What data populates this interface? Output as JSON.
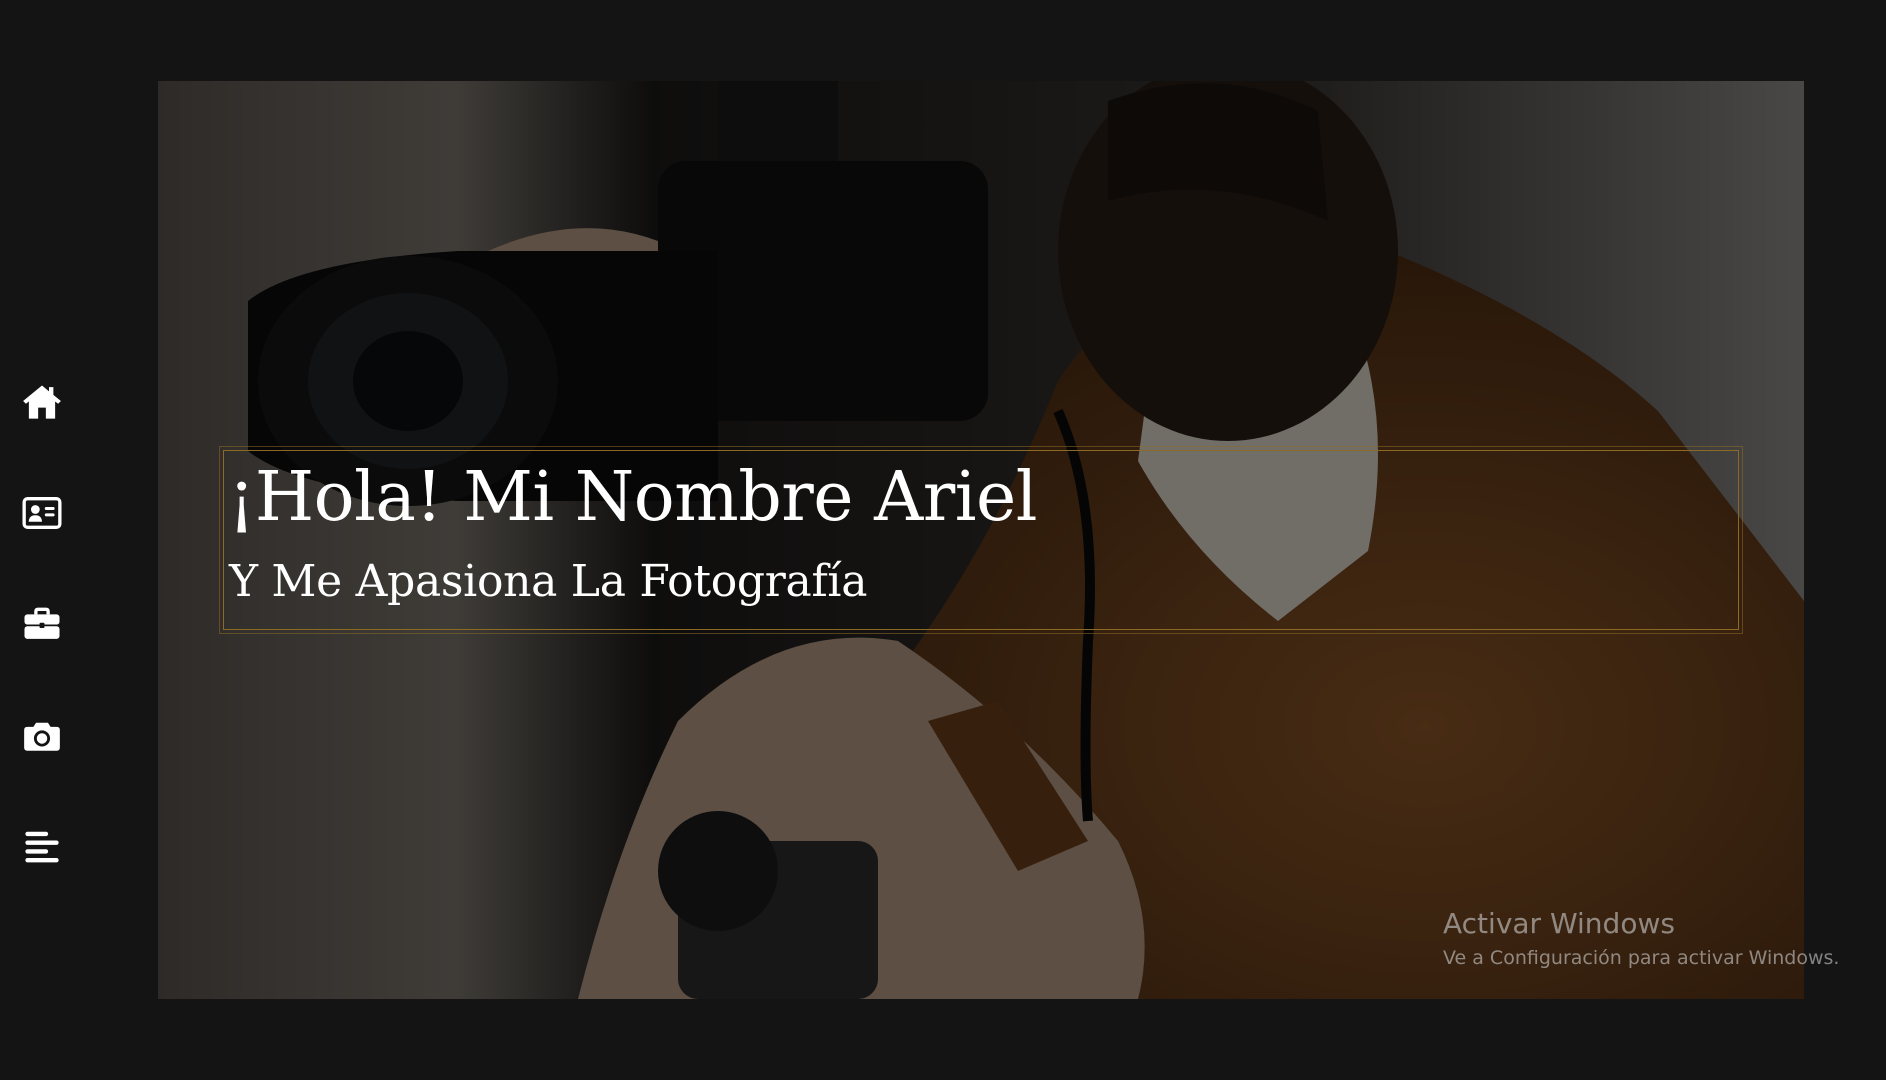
{
  "sidebar": {
    "items": [
      {
        "name": "home",
        "icon": "home-icon"
      },
      {
        "name": "about",
        "icon": "id-card-icon"
      },
      {
        "name": "work",
        "icon": "briefcase-icon"
      },
      {
        "name": "gallery",
        "icon": "camera-icon"
      },
      {
        "name": "menu",
        "icon": "align-left-icon"
      }
    ]
  },
  "hero": {
    "greeting": "¡Hola! Mi Nombre Ariel",
    "subtitle": "Y Me Apasiona La Fotografía",
    "image": "photographer-with-camera"
  },
  "watermark": {
    "title": "Activar Windows",
    "subtitle": "Ve a Configuración para activar Windows."
  },
  "colors": {
    "background": "#141414",
    "accent_border": "#8c6a24",
    "text": "#ffffff",
    "icon": "#ffffff"
  }
}
